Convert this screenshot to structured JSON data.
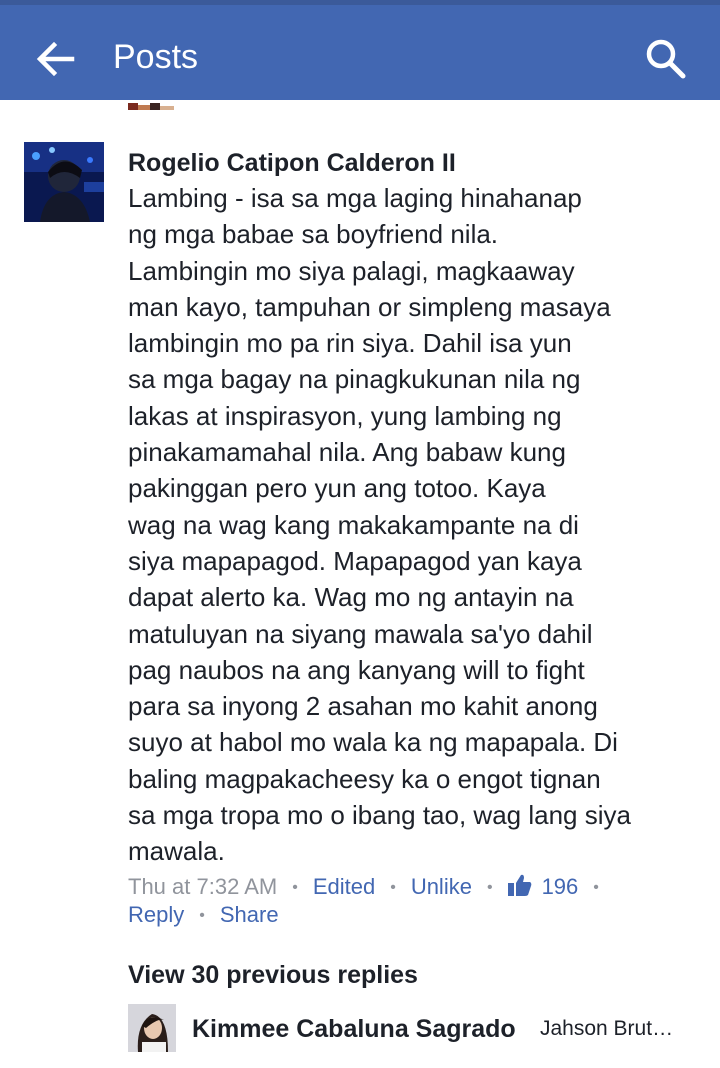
{
  "header": {
    "title": "Posts",
    "back_icon": "arrow-left-icon",
    "search_icon": "search-icon",
    "bar_color": "#4267b2"
  },
  "comment": {
    "author": "Rogelio Catipon Calderon II",
    "lines": [
      "Lambing - isa sa mga laging hinahanap",
      "ng mga babae sa boyfriend nila.",
      "Lambingin mo siya palagi, magkaaway",
      "man kayo, tampuhan or simpleng masaya",
      "lambingin mo pa rin siya. Dahil isa yun",
      "sa mga bagay na pinagkukunan nila ng",
      "lakas at inspirasyon, yung lambing ng",
      "pinakamamahal nila. Ang babaw kung",
      "pakinggan pero yun ang totoo. Kaya",
      "wag na wag kang makakampante na di",
      "siya mapapagod. Mapapagod yan kaya",
      "dapat alerto ka. Wag mo ng antayin na",
      "matuluyan na siyang mawala sa'yo dahil",
      "pag naubos na ang kanyang will to fight",
      "para sa inyong 2 asahan mo kahit anong",
      "suyo at habol mo wala ka ng mapapala. Di",
      "baling magpakacheesy ka o engot tignan",
      "sa mga tropa mo o ibang tao, wag lang siya",
      "mawala."
    ],
    "timestamp": "Thu at 7:32 AM",
    "edited_label": "Edited",
    "unlike_label": "Unlike",
    "like_icon": "thumbs-up-icon",
    "like_count": "196",
    "reply_label": "Reply",
    "share_label": "Share",
    "separator": "•"
  },
  "replies": {
    "view_previous_label": "View 30 previous replies",
    "latest": {
      "name": "Kimmee Cabaluna Sagrado",
      "snippet": "Jahson Brut…"
    }
  }
}
